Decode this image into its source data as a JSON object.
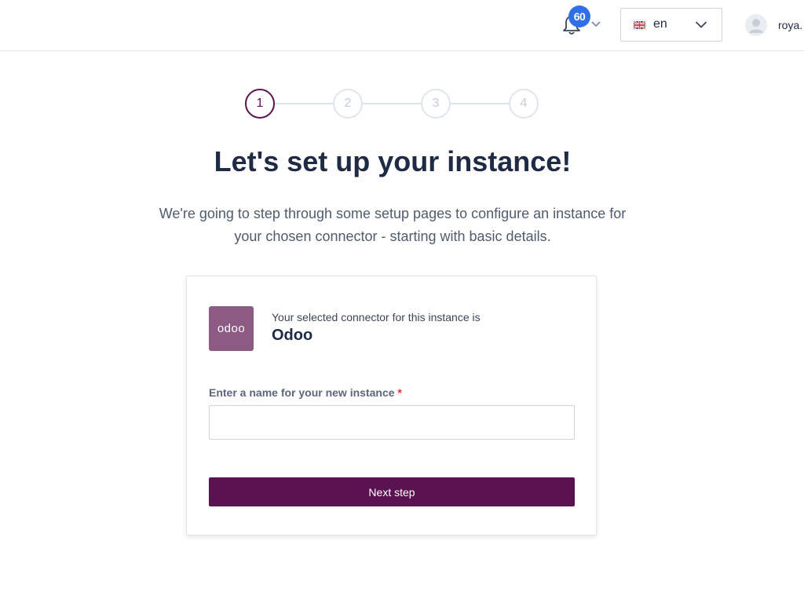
{
  "header": {
    "notifications": {
      "count": "60",
      "icon": "bell-icon"
    },
    "language": {
      "value": "en",
      "flag_icon": "uk-flag-icon"
    },
    "user": {
      "name": "roya."
    }
  },
  "stepper": {
    "steps": [
      "1",
      "2",
      "3",
      "4"
    ],
    "active_step": 1
  },
  "page": {
    "title": "Let's set up your instance!",
    "intro_line1": "We're going to step through some setup pages to configure an instance for",
    "intro_line2": "your chosen connector - starting with basic details."
  },
  "card": {
    "logo_text": "odoo",
    "selected_caption": "Your selected connector for this instance is",
    "connector_name": "Odoo",
    "name_label": "Enter a name for your new instance",
    "required_mark": "*",
    "name_value": "",
    "next_label": "Next step"
  },
  "colors": {
    "brand": "#5b1250",
    "badge": "#2f6fea",
    "odoo_logo": "#8c5a83",
    "required": "#e0322b"
  }
}
